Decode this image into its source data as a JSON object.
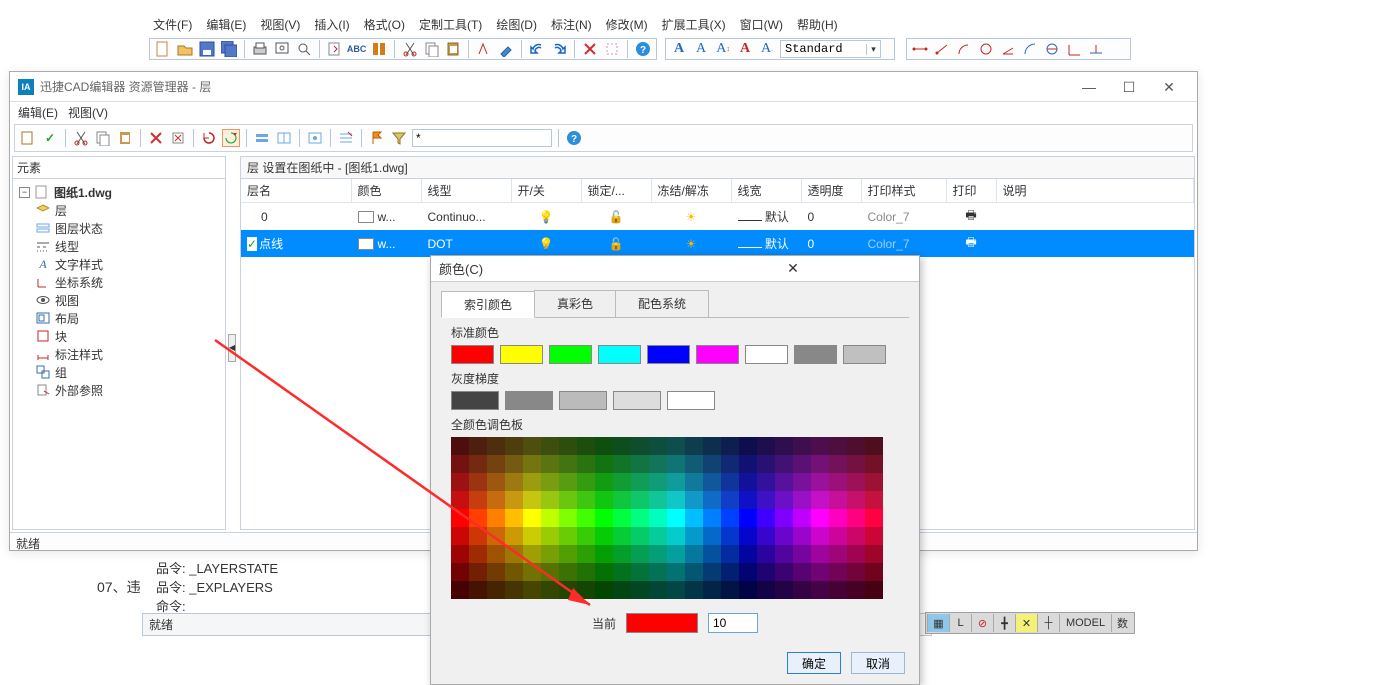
{
  "mainmenu": [
    "文件(F)",
    "编辑(E)",
    "视图(V)",
    "插入(I)",
    "格式(O)",
    "定制工具(T)",
    "绘图(D)",
    "标注(N)",
    "修改(M)",
    "扩展工具(X)",
    "窗口(W)",
    "帮助(H)"
  ],
  "toolbar": {
    "font_value": "Standard"
  },
  "rm": {
    "title": "迅捷CAD编辑器 资源管理器 - 层",
    "menu2": [
      "编辑(E)",
      "视图(V)"
    ],
    "filter_value": "*",
    "tree_hdr": "元素",
    "tree": {
      "root": "图纸1.dwg",
      "nodes": [
        "层",
        "图层状态",
        "线型",
        "文字样式",
        "坐标系统",
        "视图",
        "布局",
        "块",
        "标注样式",
        "组",
        "外部参照"
      ]
    },
    "grid_title": "层 设置在图纸中 - [图纸1.dwg]",
    "cols": [
      "层名",
      "颜色",
      "线型",
      "开/关",
      "锁定/...",
      "冻结/解冻",
      "线宽",
      "透明度",
      "打印样式",
      "打印",
      "说明"
    ],
    "rows": [
      {
        "name": "0",
        "color": "w...",
        "ltype": "Continuo...",
        "lw": "默认",
        "tr": "0",
        "ps": "Color_7",
        "sel": false
      },
      {
        "name": "点线",
        "color": "w...",
        "ltype": "DOT",
        "lw": "默认",
        "tr": "0",
        "ps": "Color_7",
        "sel": true
      }
    ],
    "status": "就绪"
  },
  "colordlg": {
    "title": "颜色(C)",
    "tabs": [
      "索引颜色",
      "真彩色",
      "配色系统"
    ],
    "std_label": "标准颜色",
    "gs_label": "灰度梯度",
    "pal_label": "全颜色调色板",
    "current_label": "当前",
    "current_value": "10",
    "ok": "确定",
    "cancel": "取消",
    "std_colors": [
      "#ff0000",
      "#ffff00",
      "#00ff00",
      "#00ffff",
      "#0000ff",
      "#ff00ff",
      "#ffffff",
      "#888888",
      "#c0c0c0"
    ],
    "gs_colors": [
      "#444444",
      "#888888",
      "#bbbbbb",
      "#dddddd",
      "#ffffff"
    ]
  },
  "bg": {
    "cmd_lines": [
      "品令:  _LAYERSTATE",
      "品令:  _EXPLAYERS",
      "命令:"
    ],
    "numlabel": "07、违",
    "status2": "就绪",
    "model": "MODEL"
  }
}
